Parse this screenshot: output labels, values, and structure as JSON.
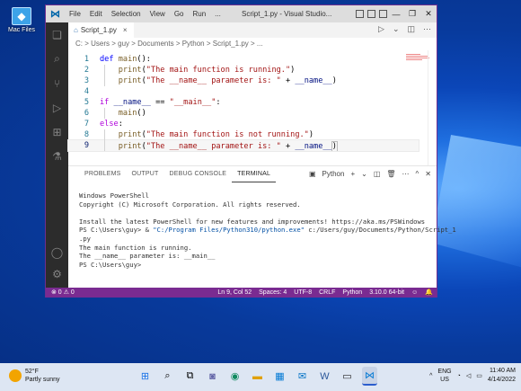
{
  "desktop": {
    "icon_label": "Mac Files"
  },
  "window": {
    "title": "Script_1.py - Visual Studio...",
    "menu": [
      "File",
      "Edit",
      "Selection",
      "View",
      "Go",
      "Run",
      "..."
    ]
  },
  "tab": {
    "label": "Script_1.py",
    "close": "×"
  },
  "breadcrumb": "C: > Users > guy > Documents > Python > Script_1.py > ...",
  "editor": {
    "line_numbers": [
      "1",
      "2",
      "3",
      "4",
      "5",
      "6",
      "7",
      "8",
      "9"
    ]
  },
  "panel": {
    "tabs": [
      "PROBLEMS",
      "OUTPUT",
      "DEBUG CONSOLE",
      "TERMINAL"
    ],
    "shell_label": "Python",
    "terminal": {
      "header": "Windows PowerShell\nCopyright (C) Microsoft Corporation. All rights reserved.\n\nInstall the latest PowerShell for new features and improvements! https://aka.ms/PSWindows\n",
      "prompt": "PS C:\\Users\\guy> & ",
      "exe": "\"C:/Program Files/Python310/python.exe\"",
      "script": " c:/Users/guy/Documents/Python/Script_1\n.py",
      "output": "The main function is running.\nThe __name__ parameter is: __main__\nPS C:\\Users\\guy> "
    }
  },
  "statusbar": {
    "problems": "⊗ 0 ⚠ 0",
    "items": [
      "Ln 9, Col 52",
      "Spaces: 4",
      "UTF-8",
      "CRLF",
      "Python",
      "3.10.0 64-bit"
    ]
  },
  "taskbar": {
    "temp": "52°F",
    "weather": "Partly sunny",
    "lang": "ENG",
    "region": "US",
    "time": "11:40 AM",
    "date": "4/14/2022"
  }
}
